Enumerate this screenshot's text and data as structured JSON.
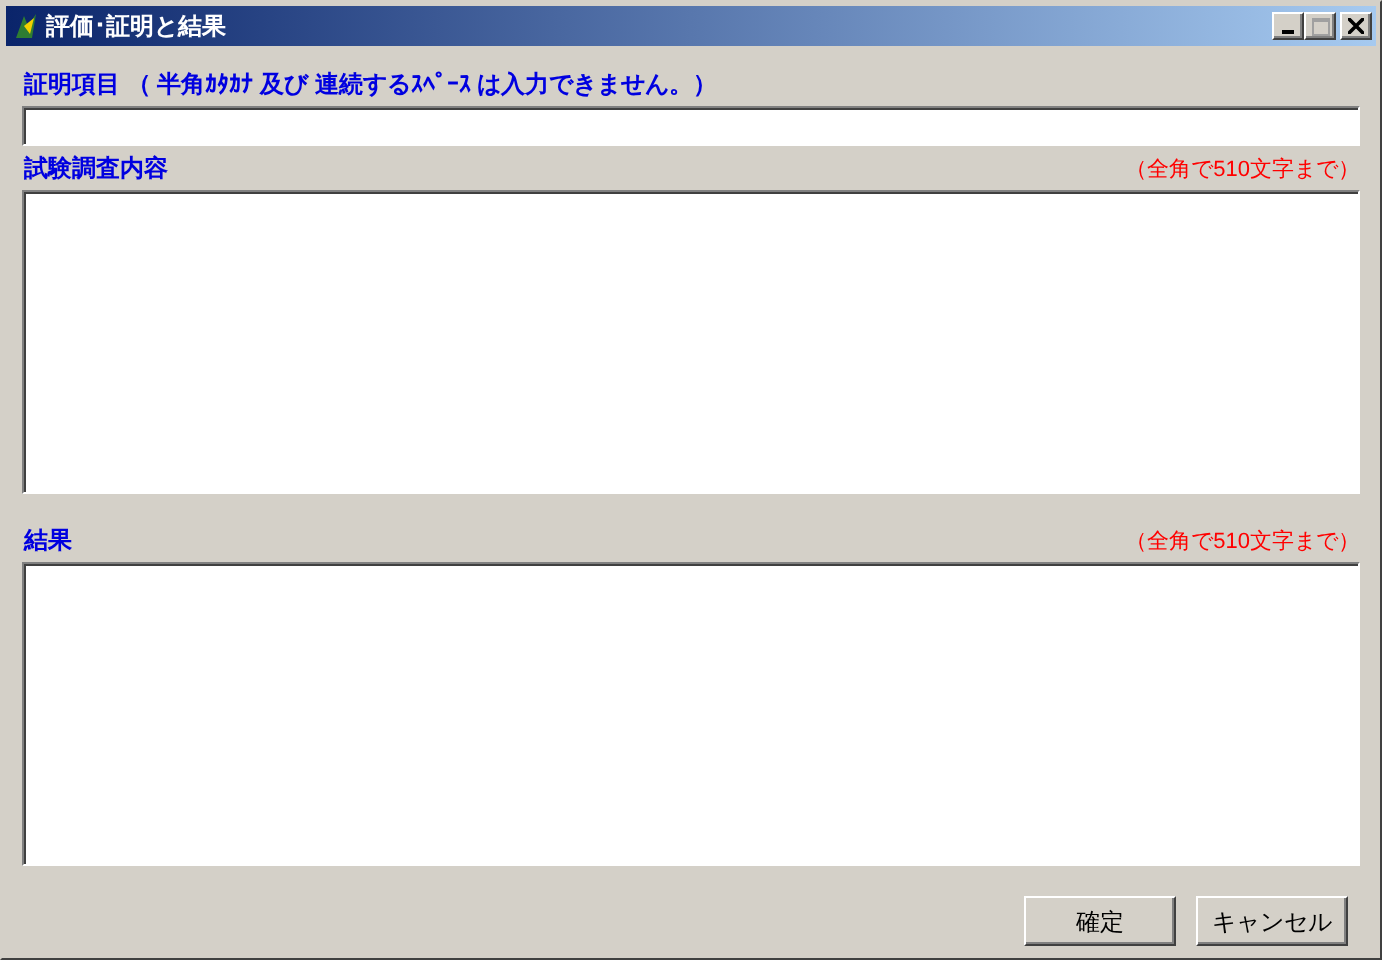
{
  "window": {
    "title": "評価･証明と結果",
    "controls": [
      {
        "kind": "minimize",
        "disabled": false
      },
      {
        "kind": "maximize",
        "disabled": true
      },
      {
        "kind": "close",
        "disabled": false
      }
    ]
  },
  "fields": [
    {
      "kind": "line",
      "label": "証明項目 （ 半角ｶﾀｶﾅ 及び 連続するｽﾍﾟｰｽ は入力できません。）"
    },
    {
      "kind": "area",
      "label": "試験調査内容",
      "note": "（全角で510文字まで）"
    },
    {
      "kind": "area",
      "label": "結果",
      "note": "（全角で510文字まで）"
    }
  ],
  "buttons": [
    "確定",
    "キャンセル"
  ]
}
